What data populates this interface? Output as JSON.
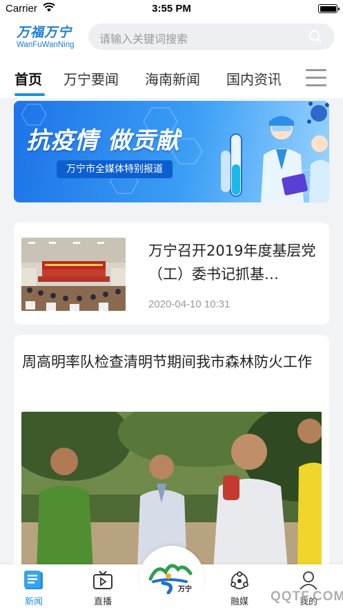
{
  "status_bar": {
    "carrier": "Carrier",
    "time": "3:55 PM"
  },
  "header": {
    "logo_cn": "万福万宁",
    "logo_en": "WanFuWanNing",
    "search_placeholder": "请输入关键词搜索"
  },
  "tabs": [
    {
      "label": "首页",
      "active": true
    },
    {
      "label": "万宁要闻",
      "active": false
    },
    {
      "label": "海南新闻",
      "active": false
    },
    {
      "label": "国内资讯",
      "active": false
    }
  ],
  "banner": {
    "title": "抗疫情 做贡献",
    "subtitle": "万宁市全媒体特别报道"
  },
  "articles": [
    {
      "title": "万宁召开2019年度基层党（工）委书记抓基…",
      "time": "2020-04-10 10:31"
    },
    {
      "title": "周高明率队检查清明节期间我市森林防火工作"
    }
  ],
  "bottom_nav": [
    {
      "label": "新闻",
      "icon": "news-icon",
      "active": true
    },
    {
      "label": "直播",
      "icon": "live-tv-icon",
      "active": false
    },
    {
      "label": "融媒",
      "icon": "media-hub-icon",
      "active": false
    },
    {
      "label": "我的",
      "icon": "profile-icon",
      "active": false
    }
  ],
  "nav_center_logo": "万宁",
  "watermark": "QQTF.COM",
  "colors": {
    "accent": "#1e8fe0",
    "brand": "#1a7fd1"
  }
}
